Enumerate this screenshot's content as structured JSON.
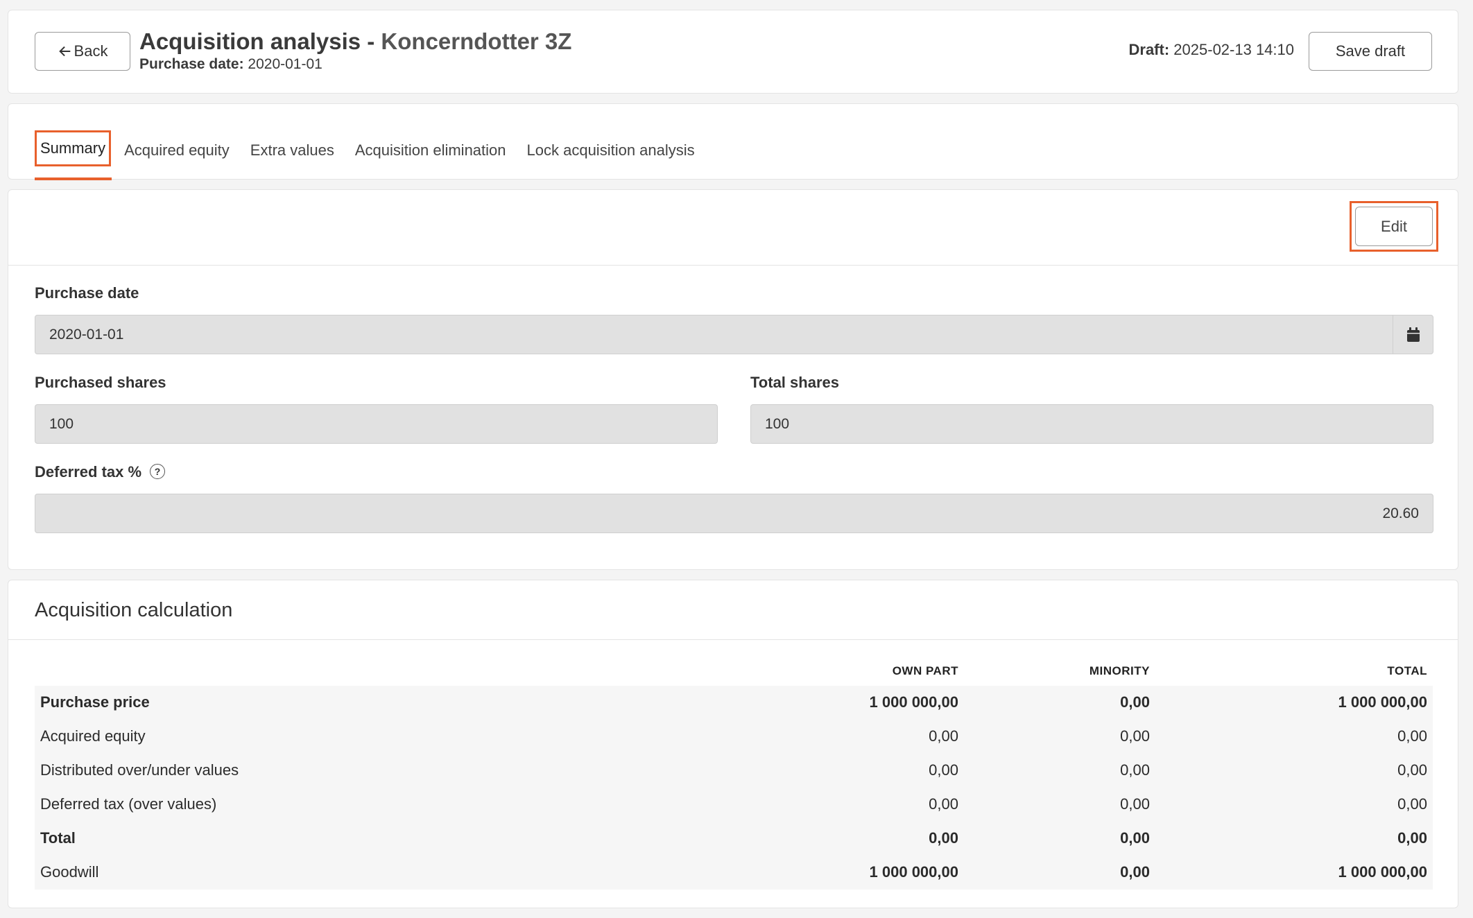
{
  "header": {
    "back_label": "Back",
    "title_prefix": "Acquisition analysis - ",
    "company": "Koncerndotter 3Z",
    "purchase_date_label": "Purchase date:",
    "purchase_date_value": "2020-01-01",
    "draft_label": "Draft:",
    "draft_value": "2025-02-13 14:10",
    "save_label": "Save draft"
  },
  "tabs": [
    {
      "label": "Summary",
      "active": true
    },
    {
      "label": "Acquired equity"
    },
    {
      "label": "Extra values"
    },
    {
      "label": "Acquisition elimination"
    },
    {
      "label": "Lock acquisition analysis"
    }
  ],
  "form": {
    "edit_label": "Edit",
    "purchase_date_label": "Purchase date",
    "purchase_date_value": "2020-01-01",
    "purchased_shares_label": "Purchased shares",
    "purchased_shares_value": "100",
    "total_shares_label": "Total shares",
    "total_shares_value": "100",
    "deferred_tax_label": "Deferred tax %",
    "deferred_tax_value": "20.60",
    "help_icon_glyph": "?"
  },
  "calculation": {
    "title": "Acquisition calculation",
    "columns": [
      "OWN PART",
      "MINORITY",
      "TOTAL"
    ],
    "rows": [
      {
        "label": "Purchase price",
        "own": "1 000 000,00",
        "minority": "0,00",
        "total": "1 000 000,00",
        "bold": true
      },
      {
        "label": "Acquired equity",
        "own": "0,00",
        "minority": "0,00",
        "total": "0,00"
      },
      {
        "label": "Distributed over/under values",
        "own": "0,00",
        "minority": "0,00",
        "total": "0,00"
      },
      {
        "label": "Deferred tax (over values)",
        "own": "0,00",
        "minority": "0,00",
        "total": "0,00"
      },
      {
        "label": "Total",
        "own": "0,00",
        "minority": "0,00",
        "total": "0,00",
        "bold": true
      },
      {
        "label": "Goodwill",
        "own": "1 000 000,00",
        "minority": "0,00",
        "total": "1 000 000,00",
        "boldNums": true
      }
    ]
  },
  "colors": {
    "accent": "#e8602c",
    "field_bg": "#e1e1e1",
    "table_bg": "#f6f6f6"
  }
}
